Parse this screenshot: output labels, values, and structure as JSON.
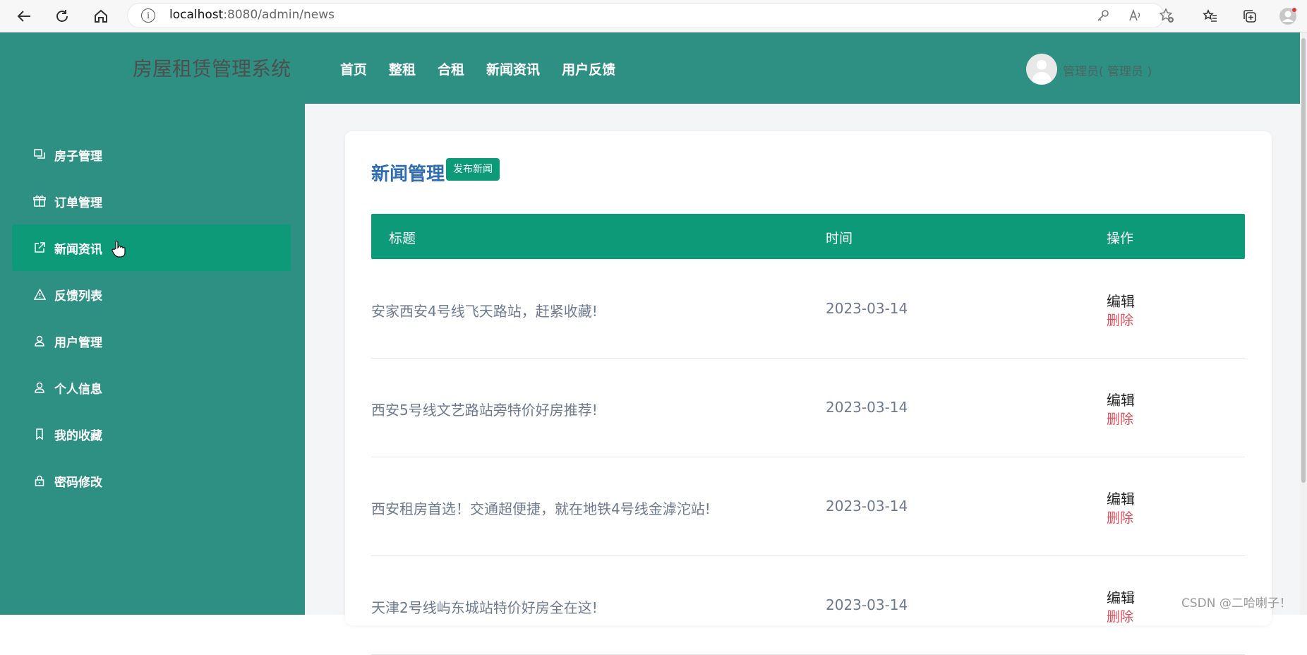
{
  "browser": {
    "url_host": "localhost",
    "url_path": ":8080/admin/news",
    "info_glyph": "i"
  },
  "app": {
    "brand": "房屋租赁管理系统",
    "nav": [
      "首页",
      "整租",
      "合租",
      "新闻资讯",
      "用户反馈"
    ],
    "user_label": "管理员( 管理员 )"
  },
  "sidebar": {
    "items": [
      {
        "label": "房子管理",
        "icon": "house-icon",
        "active": false
      },
      {
        "label": "订单管理",
        "icon": "gift-icon",
        "active": false
      },
      {
        "label": "新闻资讯",
        "icon": "external-link-icon",
        "active": true
      },
      {
        "label": "反馈列表",
        "icon": "warning-icon",
        "active": false
      },
      {
        "label": "用户管理",
        "icon": "user-icon",
        "active": false
      },
      {
        "label": "个人信息",
        "icon": "user-icon",
        "active": false
      },
      {
        "label": "我的收藏",
        "icon": "bookmark-icon",
        "active": false
      },
      {
        "label": "密码修改",
        "icon": "lock-icon",
        "active": false
      }
    ]
  },
  "page": {
    "title": "新闻管理",
    "publish_button": "发布新闻"
  },
  "table": {
    "headers": [
      "标题",
      "时间",
      "操作"
    ],
    "rows": [
      {
        "title": "安家西安4号线飞天路站，赶紧收藏!",
        "time": "2023-03-14"
      },
      {
        "title": "西安5号线文艺路站旁特价好房推荐!",
        "time": "2023-03-14"
      },
      {
        "title": "西安租房首选！交通超便捷，就在地铁4号线金滹沱站!",
        "time": "2023-03-14"
      },
      {
        "title": "天津2号线屿东城站特价好房全在这!",
        "time": "2023-03-14"
      }
    ],
    "edit_label": "编辑",
    "delete_label": "删除"
  },
  "watermark": "CSDN @二哈喇子！"
}
